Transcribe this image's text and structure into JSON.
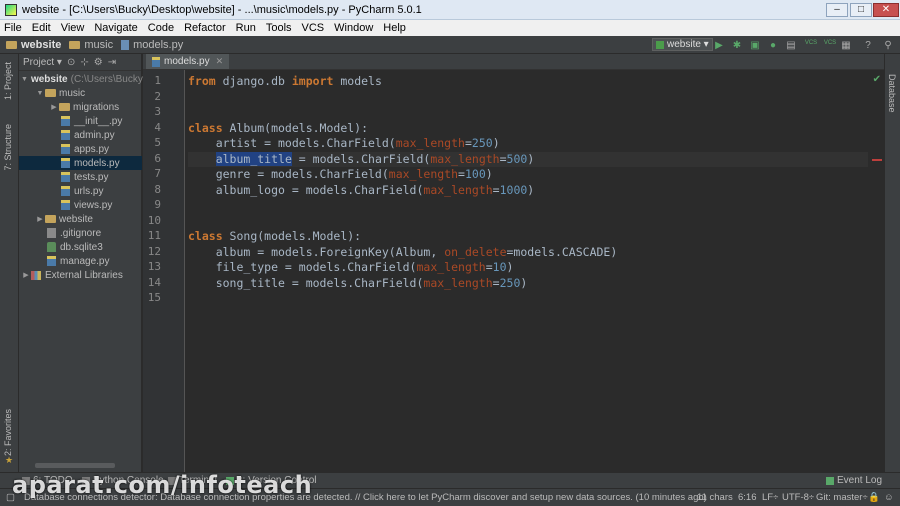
{
  "window": {
    "title": "website - [C:\\Users\\Bucky\\Desktop\\website] - ...\\music\\models.py - PyCharm 5.0.1",
    "min": "–",
    "max": "□",
    "close": "✕"
  },
  "menu": [
    "File",
    "Edit",
    "View",
    "Navigate",
    "Code",
    "Refactor",
    "Run",
    "Tools",
    "VCS",
    "Window",
    "Help"
  ],
  "breadcrumb": [
    "website",
    "music",
    "models.py"
  ],
  "toolbar": {
    "run_config": "website",
    "vcs1": "VCS",
    "vcs2": "VCS"
  },
  "left_strip": {
    "project": "1: Project",
    "structure": "7: Structure",
    "favorites": "2: Favorites"
  },
  "right_strip": {
    "database": "Database"
  },
  "project_panel": {
    "title": "Project",
    "items": [
      {
        "label": "website",
        "hint": "(C:\\Users\\Bucky\\..."
      },
      {
        "label": "music"
      },
      {
        "label": "migrations"
      },
      {
        "label": "__init__.py"
      },
      {
        "label": "admin.py"
      },
      {
        "label": "apps.py"
      },
      {
        "label": "models.py"
      },
      {
        "label": "tests.py"
      },
      {
        "label": "urls.py"
      },
      {
        "label": "views.py"
      },
      {
        "label": "website"
      },
      {
        "label": ".gitignore"
      },
      {
        "label": "db.sqlite3"
      },
      {
        "label": "manage.py"
      },
      {
        "label": "External Libraries"
      }
    ]
  },
  "editor": {
    "tab": "models.py",
    "line_numbers": [
      "1",
      "2",
      "3",
      "4",
      "5",
      "6",
      "7",
      "8",
      "9",
      "10",
      "11",
      "12",
      "13",
      "14",
      "15"
    ],
    "code": {
      "l1_from": "from",
      "l1_mod": " django.db ",
      "l1_import": "import",
      "l1_name": " models",
      "l4_class": "class",
      "l4_rest": " Album(models.Model):",
      "l5_a": "    artist = models.CharField(",
      "l5_p": "max_length",
      "l5_eq": "=",
      "l5_n": "250",
      "l5_c": ")",
      "l6_indent": "    ",
      "l6_sel": "album_title",
      "l6_a": " = models.CharField(",
      "l6_p": "max_length",
      "l6_eq": "=",
      "l6_n": "500",
      "l6_c": ")",
      "l7_a": "    genre = models.CharField(",
      "l7_p": "max_length",
      "l7_eq": "=",
      "l7_n": "100",
      "l7_c": ")",
      "l8_a": "    album_logo = models.CharField(",
      "l8_p": "max_length",
      "l8_eq": "=",
      "l8_n": "1000",
      "l8_c": ")",
      "l11_class": "class",
      "l11_rest": " Song(models.Model):",
      "l12_a": "    album = models.ForeignKey(Album, ",
      "l12_p": "on_delete",
      "l12_b": "=models.CASCADE)",
      "l13_a": "    file_type = models.CharField(",
      "l13_p": "max_length",
      "l13_eq": "=",
      "l13_n": "10",
      "l13_c": ")",
      "l14_a": "    song_title = models.CharField(",
      "l14_p": "max_length",
      "l14_eq": "=",
      "l14_n": "250",
      "l14_c": ")"
    }
  },
  "bottom_tabs": {
    "todo": "6: TODO",
    "python_console": "Python Console",
    "terminal": "Terminal",
    "version_control": "9: Version Control",
    "event_log": "Event Log"
  },
  "status": {
    "message": "Database connections detector: Database connection properties are detected. // Click here to let PyCharm discover and setup new data sources. (10 minutes ago)",
    "chars": "11 chars",
    "position": "6:16",
    "line_sep": "LF÷",
    "encoding": "UTF-8÷",
    "git": "Git: master÷"
  },
  "watermark": "aparat.com/infoteach"
}
